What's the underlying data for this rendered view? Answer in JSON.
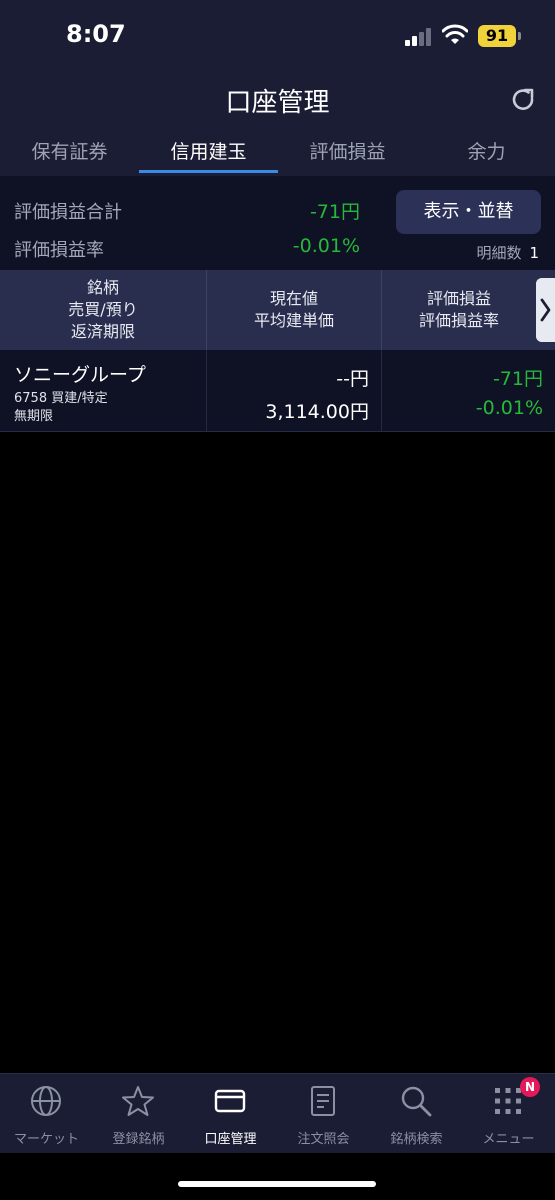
{
  "status_bar": {
    "time": "8:07",
    "battery": "91"
  },
  "header": {
    "title": "口座管理"
  },
  "tabs": [
    {
      "label": "保有証券"
    },
    {
      "label": "信用建玉"
    },
    {
      "label": "評価損益"
    },
    {
      "label": "余力"
    }
  ],
  "summary": {
    "total_label": "評価損益合計",
    "total_value": "-71円",
    "rate_label": "評価損益率",
    "rate_value": "-0.01%",
    "sort_button": "表示・並替",
    "count_label": "明細数",
    "count_value": "1"
  },
  "table": {
    "headers": [
      [
        "銘柄",
        "売買/預り",
        "返済期限"
      ],
      [
        "現在値",
        "平均建単価"
      ],
      [
        "評価損益",
        "評価損益率"
      ]
    ],
    "rows": [
      {
        "name": "ソニーグループ",
        "code_trade": "6758 買建/特定",
        "deadline": "無期限",
        "current_price": "--円",
        "avg_price": "3,114.00円",
        "pl": "-71円",
        "pl_rate": "-0.01%"
      }
    ]
  },
  "bottom_nav": [
    {
      "label": "マーケット",
      "icon": "globe-icon"
    },
    {
      "label": "登録銘柄",
      "icon": "star-icon"
    },
    {
      "label": "口座管理",
      "icon": "card-icon"
    },
    {
      "label": "注文照会",
      "icon": "document-icon"
    },
    {
      "label": "銘柄検索",
      "icon": "search-icon"
    },
    {
      "label": "メニュー",
      "icon": "grid-icon"
    }
  ],
  "menu_badge": "N",
  "colors": {
    "positive_green": "#27b83a",
    "accent_blue": "#3b8ae6",
    "badge_red": "#e5195a"
  }
}
